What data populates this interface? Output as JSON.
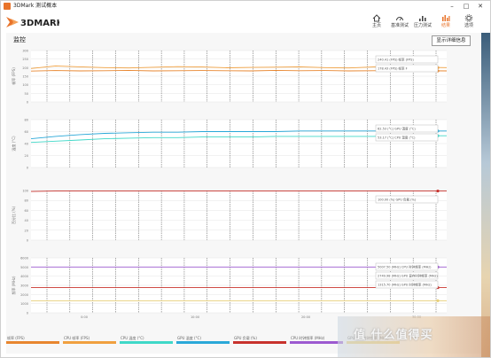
{
  "window": {
    "title": "3DMark 测试概本"
  },
  "header": {
    "logo_text": "3DMARK",
    "nav": [
      {
        "label": "主页",
        "icon": "home-icon"
      },
      {
        "label": "基准测试",
        "icon": "gauge-icon"
      },
      {
        "label": "压力测试",
        "icon": "stress-icon"
      },
      {
        "label": "结果",
        "icon": "results-icon",
        "active": true
      },
      {
        "label": "选项",
        "icon": "gear-icon"
      }
    ]
  },
  "page": {
    "title": "监控",
    "detail_button": "显示详细信息"
  },
  "chart_data": [
    {
      "type": "line",
      "ylabel": "帧率 (FPS)",
      "ylim": [
        0,
        300
      ],
      "yticks": [
        "300",
        "250",
        "200",
        "150",
        "100",
        "50",
        "0"
      ],
      "series": [
        {
          "name": "帧率 (FPS)",
          "color": "#f0a040",
          "values": [
            195,
            210,
            205,
            200,
            198,
            202,
            206,
            204,
            199,
            201,
            203,
            205,
            200,
            198,
            204,
            207,
            202,
            200
          ]
        },
        {
          "name": "帧率 (FPS)",
          "color": "#e8862f",
          "values": [
            180,
            183,
            181,
            182,
            184,
            181,
            182,
            183,
            182,
            181,
            184,
            182,
            183,
            181,
            182,
            183,
            182,
            181
          ]
        }
      ],
      "tooltips": [
        "240.41 (FPS) 帧率 (FPS)",
        "178.43 (FPS) 帧率 F"
      ]
    },
    {
      "type": "line",
      "ylabel": "温度 (°C)",
      "ylim": [
        0,
        80
      ],
      "yticks": [
        "80",
        "60",
        "40",
        "20",
        "0"
      ],
      "series": [
        {
          "name": "CPU 温度 (°C)",
          "color": "#40d8c8",
          "values": [
            42,
            44,
            46,
            48,
            49,
            50,
            50,
            51,
            51,
            51,
            52,
            52,
            52,
            52,
            52,
            53,
            53,
            53
          ]
        },
        {
          "name": "GPU 温度 (°C)",
          "color": "#2aa8d8",
          "values": [
            48,
            52,
            55,
            57,
            58,
            59,
            59,
            60,
            60,
            60,
            60,
            61,
            61,
            61,
            61,
            61,
            61,
            61
          ]
        }
      ],
      "tooltips": [
        "62.53 (°C) GPU 温度 (°C)",
        "53.17 (°C) CPU 温度 (°C)"
      ]
    },
    {
      "type": "line",
      "ylabel": "百分比 (%)",
      "ylim": [
        0,
        100
      ],
      "yticks": [
        "100",
        "80",
        "60",
        "40",
        "20",
        "0"
      ],
      "series": [
        {
          "name": "GPU 负载 (%)",
          "color": "#c8322d",
          "values": [
            98,
            99,
            99,
            99,
            99,
            99,
            99,
            99,
            99,
            99,
            99,
            99,
            99,
            99,
            99,
            99,
            99,
            99
          ]
        }
      ],
      "tooltips": [
        "100.00 (%) GPU 负载 (%)"
      ]
    },
    {
      "type": "line",
      "ylabel": "频率 (MHz)",
      "ylim": [
        0,
        6000
      ],
      "yticks": [
        "6000",
        "5000",
        "4000",
        "3000",
        "2000",
        "1000",
        "0"
      ],
      "series": [
        {
          "name": "CPU 时钟频率 (MHz)",
          "color": "#9c5ad0",
          "values": [
            5000,
            5000,
            5000,
            5000,
            5000,
            5000,
            5000,
            5000,
            5000,
            5000,
            5000,
            5000,
            5000,
            5000,
            5000,
            5000,
            5000,
            5000
          ]
        },
        {
          "name": "GPU 显存时钟频率 (MHz)",
          "color": "#c8322d",
          "values": [
            2750,
            2750,
            2750,
            2750,
            2750,
            2750,
            2750,
            2750,
            2750,
            2750,
            2750,
            2750,
            2750,
            2750,
            2750,
            2750,
            2750,
            2750
          ]
        },
        {
          "name": "GPU 时钟频率 (MHz)",
          "color": "#e8d07a",
          "values": [
            1315,
            1315,
            1315,
            1315,
            1315,
            1315,
            1315,
            1315,
            1315,
            1315,
            1315,
            1315,
            1315,
            1315,
            1315,
            1315,
            1315,
            1315
          ]
        }
      ],
      "tooltips": [
        "5007.50 (MHz) CPU 时钟频率 (MHz)",
        "2749.98 (MHz) GPU 显存时钟频率 (MHz)",
        "1315.70 (MHz) GPU 时钟频率 (MHz)"
      ]
    }
  ],
  "time_axis": [
    "0:00",
    "10:00",
    "20:00",
    "30:00"
  ],
  "legend": [
    {
      "label": "帧率 (FPS)",
      "color": "#e8862f"
    },
    {
      "label": "CPU 帧率 (FPS)",
      "color": "#f0a040"
    },
    {
      "label": "CPU 温度 (°C)",
      "color": "#40d8c8"
    },
    {
      "label": "GPU 温度 (°C)",
      "color": "#2aa8d8"
    },
    {
      "label": "GPU 负载 (%)",
      "color": "#c8322d"
    },
    {
      "label": "CPU 时钟频率 (MHz)",
      "color": "#9c5ad0"
    },
    {
      "label": "GPU 显存时钟频率 (MHz)",
      "color": "#e8d07a"
    }
  ],
  "watermark": "值 什么值得买"
}
